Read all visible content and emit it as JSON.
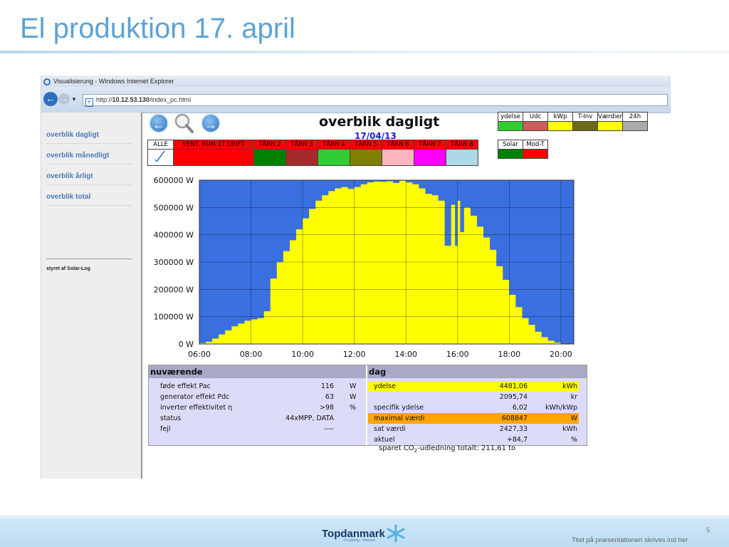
{
  "slide": {
    "title": "El produktion 17. april",
    "page_number": "5",
    "footer_note": "Titel på præsentationen skrives ind her",
    "brand": "Topdanmark",
    "brand_sub": "Forsikring · Pension"
  },
  "browser": {
    "window_title": "Visualisierung - Windows Internet Explorer",
    "address_prefix": "http://",
    "address_host": "10.12.53.130",
    "address_path": "/index_pc.html"
  },
  "sidebar": {
    "items": [
      {
        "label": "overblik dagligt"
      },
      {
        "label": "overblik månedligt"
      },
      {
        "label": "overblik årligt"
      },
      {
        "label": "overblik total"
      }
    ],
    "credit": "styret af Solar-Log"
  },
  "header": {
    "heading": "overblik dagligt",
    "date": "17/04/13"
  },
  "inverter_row": {
    "labels": [
      "ALLE",
      "VENT. RUM 1T DRIFT",
      "TÅRN 2",
      "TÅRN 3",
      "TÅRN 4",
      "TÅRN 5",
      "TÅRN 6",
      "TÅRN 7",
      "TÅRN 8"
    ],
    "colors": [
      "#ffffff",
      "#ff0000",
      "#008000",
      "#a52a2a",
      "#33cc33",
      "#808000",
      "#ffb6c1",
      "#ff00ff",
      "#add8e6"
    ]
  },
  "legend_row": {
    "labels": [
      "ydelse",
      "Udc",
      "kWp",
      "T-Inv",
      "Værdier",
      "24h"
    ],
    "colors": [
      "#33cc33",
      "#cd5c5c",
      "#ffff00",
      "#6b6b1a",
      "#ffff00",
      "#aaaaaa"
    ]
  },
  "legend_row2": {
    "labels": [
      "Solar",
      "Mod-T"
    ],
    "colors": [
      "#008000",
      "#ff0000"
    ]
  },
  "chart_data": {
    "type": "area",
    "ylabels": [
      "600000 W",
      "500000 W",
      "400000 W",
      "300000 W",
      "200000 W",
      "100000 W",
      "0 W"
    ],
    "xlabels": [
      "06:00",
      "08:00",
      "10:00",
      "12:00",
      "14:00",
      "16:00",
      "18:00",
      "20:00"
    ],
    "ylim": [
      0,
      600000
    ],
    "xlim_hours": [
      6,
      20.5
    ],
    "grid": true,
    "background": "#3a6fe0",
    "fill": "#ffff00",
    "x_hours": [
      6.0,
      6.25,
      6.5,
      6.75,
      7.0,
      7.25,
      7.5,
      7.75,
      8.0,
      8.25,
      8.5,
      8.75,
      9.0,
      9.25,
      9.5,
      9.75,
      10.0,
      10.25,
      10.5,
      10.75,
      11.0,
      11.25,
      11.5,
      11.75,
      12.0,
      12.25,
      12.5,
      12.75,
      13.0,
      13.25,
      13.5,
      13.75,
      14.0,
      14.25,
      14.5,
      14.75,
      15.0,
      15.25,
      15.5,
      15.75,
      15.9,
      16.0,
      16.1,
      16.25,
      16.5,
      16.75,
      17.0,
      17.25,
      17.5,
      17.75,
      18.0,
      18.25,
      18.5,
      18.75,
      19.0,
      19.25,
      19.5,
      19.75,
      20.0
    ],
    "y_watts": [
      3000,
      8000,
      20000,
      35000,
      50000,
      65000,
      75000,
      85000,
      90000,
      95000,
      120000,
      240000,
      300000,
      340000,
      380000,
      420000,
      460000,
      495000,
      525000,
      545000,
      560000,
      570000,
      575000,
      568000,
      575000,
      585000,
      592000,
      595000,
      594000,
      596000,
      590000,
      598000,
      592000,
      585000,
      570000,
      550000,
      545000,
      525000,
      360000,
      510000,
      360000,
      525000,
      410000,
      500000,
      470000,
      430000,
      390000,
      345000,
      285000,
      235000,
      180000,
      135000,
      95000,
      70000,
      45000,
      25000,
      12000,
      5000,
      1000
    ]
  },
  "stats": {
    "current": {
      "title": "nuværende",
      "rows": [
        {
          "label": "føde effekt Pac",
          "value": "116",
          "unit": "W"
        },
        {
          "label": "generator effekt Pdc",
          "value": "63",
          "unit": "W"
        },
        {
          "label": "inverter effektivitet η",
          "value": ">98",
          "unit": "%"
        },
        {
          "label": "status",
          "value": "44xMPP, DATA",
          "unit": ""
        },
        {
          "label": "fejl",
          "value": "----",
          "unit": ""
        }
      ]
    },
    "day": {
      "title": "dag",
      "rows": [
        {
          "label": "ydelse",
          "value": "4481,06",
          "unit": "kWh",
          "highlight": "#ffff00"
        },
        {
          "label": "",
          "value": "2095,74",
          "unit": "kr",
          "highlight": ""
        },
        {
          "label": "specifik ydelse",
          "value": "6,02",
          "unit": "kWh/kWp",
          "highlight": ""
        },
        {
          "label": "maximal værdi",
          "value": "608847",
          "unit": "W",
          "highlight": "#ffa500"
        },
        {
          "label": "sat værdi",
          "value": "2427,33",
          "unit": "kWh",
          "highlight": ""
        },
        {
          "label": "aktuel",
          "value": "+84,7",
          "unit": "%",
          "highlight": ""
        }
      ]
    },
    "co2_prefix": "sparet CO",
    "co2_sub": "2",
    "co2_suffix": "-udledning totalt: 211,61 to"
  }
}
